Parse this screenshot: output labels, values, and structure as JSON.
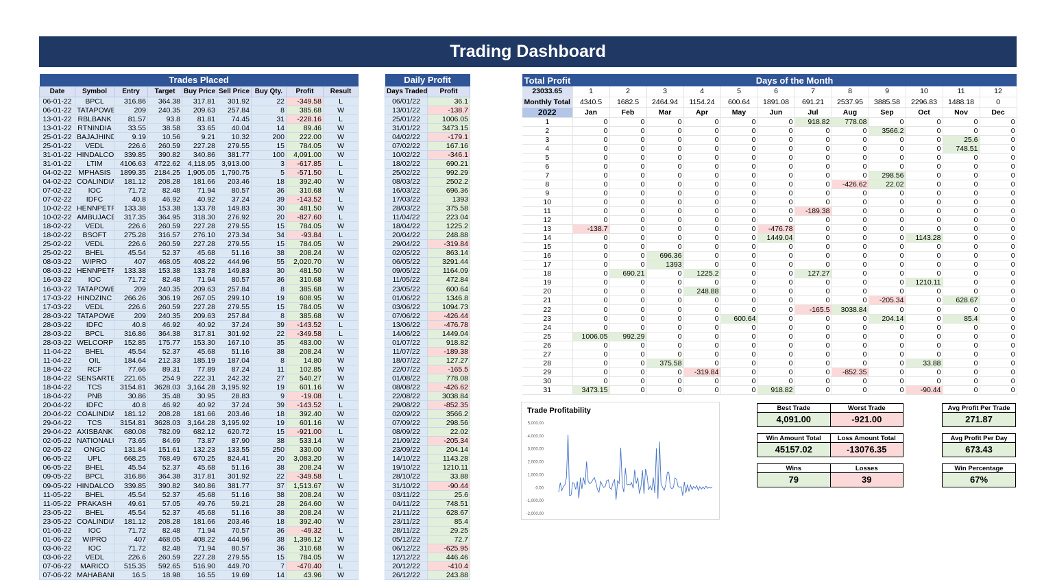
{
  "title": "Trading Dashboard",
  "trades": {
    "header": "Trades Placed",
    "columns": [
      "Date",
      "Symbol",
      "Entry",
      "Target",
      "Buy Price",
      "Sell Price",
      "Buy Qty.",
      "Profit",
      "Result"
    ],
    "rows": [
      [
        "06-01-22",
        "BPCL",
        "316.86",
        "364.38",
        "317.81",
        "301.92",
        "22",
        "-349.58",
        "L"
      ],
      [
        "06-01-22",
        "TATAPOWER",
        "209",
        "240.35",
        "209.63",
        "257.84",
        "8",
        "385.68",
        "W"
      ],
      [
        "13-01-22",
        "RBLBANK",
        "81.57",
        "93.8",
        "81.81",
        "74.45",
        "31",
        "-228.16",
        "L"
      ],
      [
        "13-01-22",
        "RTNINDIA",
        "33.55",
        "38.58",
        "33.65",
        "40.04",
        "14",
        "89.46",
        "W"
      ],
      [
        "25-01-22",
        "BAJAJHIND",
        "9.19",
        "10.56",
        "9.21",
        "10.32",
        "200",
        "222.00",
        "W"
      ],
      [
        "25-01-22",
        "VEDL",
        "226.6",
        "260.59",
        "227.28",
        "279.55",
        "15",
        "784.05",
        "W"
      ],
      [
        "31-01-22",
        "HINDALCO",
        "339.85",
        "390.82",
        "340.86",
        "381.77",
        "100",
        "4,091.00",
        "W"
      ],
      [
        "31-01-22",
        "LTIM",
        "4106.63",
        "4722.62",
        "4,118.95",
        "3,913.00",
        "3",
        "-617.85",
        "L"
      ],
      [
        "04-02-22",
        "MPHASIS",
        "1899.35",
        "2184.25",
        "1,905.05",
        "1,790.75",
        "5",
        "-571.50",
        "L"
      ],
      [
        "04-02-22",
        "COALINDIA",
        "181.12",
        "208.28",
        "181.66",
        "203.46",
        "18",
        "392.40",
        "W"
      ],
      [
        "07-02-22",
        "IOC",
        "71.72",
        "82.48",
        "71.94",
        "80.57",
        "36",
        "310.68",
        "W"
      ],
      [
        "07-02-22",
        "IDFC",
        "40.8",
        "46.92",
        "40.92",
        "37.24",
        "39",
        "-143.52",
        "L"
      ],
      [
        "10-02-22",
        "HENNPETRO",
        "133.38",
        "153.38",
        "133.78",
        "149.83",
        "30",
        "481.50",
        "W"
      ],
      [
        "10-02-22",
        "AMBUJACEM",
        "317.35",
        "364.95",
        "318.30",
        "276.92",
        "20",
        "-827.60",
        "L"
      ],
      [
        "18-02-22",
        "VEDL",
        "226.6",
        "260.59",
        "227.28",
        "279.55",
        "15",
        "784.05",
        "W"
      ],
      [
        "18-02-22",
        "BSOFT",
        "275.28",
        "316.57",
        "276.10",
        "273.34",
        "34",
        "-93.84",
        "L"
      ],
      [
        "25-02-22",
        "VEDL",
        "226.6",
        "260.59",
        "227.28",
        "279.55",
        "15",
        "784.05",
        "W"
      ],
      [
        "25-02-22",
        "BHEL",
        "45.54",
        "52.37",
        "45.68",
        "51.16",
        "38",
        "208.24",
        "W"
      ],
      [
        "08-03-22",
        "WIPRO",
        "407",
        "468.05",
        "408.22",
        "444.96",
        "55",
        "2,020.70",
        "W"
      ],
      [
        "08-03-22",
        "HENNPETRO",
        "133.38",
        "153.38",
        "133.78",
        "149.83",
        "30",
        "481.50",
        "W"
      ],
      [
        "16-03-22",
        "IOC",
        "71.72",
        "82.48",
        "71.94",
        "80.57",
        "36",
        "310.68",
        "W"
      ],
      [
        "16-03-22",
        "TATAPOWER",
        "209",
        "240.35",
        "209.63",
        "257.84",
        "8",
        "385.68",
        "W"
      ],
      [
        "17-03-22",
        "HINDZINC",
        "266.26",
        "306.19",
        "267.05",
        "299.10",
        "19",
        "608.95",
        "W"
      ],
      [
        "17-03-22",
        "VEDL",
        "226.6",
        "260.59",
        "227.28",
        "279.55",
        "15",
        "784.05",
        "W"
      ],
      [
        "28-03-22",
        "TATAPOWER",
        "209",
        "240.35",
        "209.63",
        "257.84",
        "8",
        "385.68",
        "W"
      ],
      [
        "28-03-22",
        "IDFC",
        "40.8",
        "46.92",
        "40.92",
        "37.24",
        "39",
        "-143.52",
        "L"
      ],
      [
        "28-03-22",
        "BPCL",
        "316.86",
        "364.38",
        "317.81",
        "301.92",
        "22",
        "-349.58",
        "L"
      ],
      [
        "28-03-22",
        "WELCORP",
        "152.85",
        "175.77",
        "153.30",
        "167.10",
        "35",
        "483.00",
        "W"
      ],
      [
        "11-04-22",
        "BHEL",
        "45.54",
        "52.37",
        "45.68",
        "51.16",
        "38",
        "208.24",
        "W"
      ],
      [
        "11-04-22",
        "OIL",
        "184.64",
        "212.33",
        "185.19",
        "187.04",
        "8",
        "14.80",
        "W"
      ],
      [
        "18-04-22",
        "RCF",
        "77.66",
        "89.31",
        "77.89",
        "87.24",
        "11",
        "102.85",
        "W"
      ],
      [
        "18-04-22",
        "SENSARTECH",
        "221.65",
        "254.9",
        "222.31",
        "242.32",
        "27",
        "540.27",
        "W"
      ],
      [
        "18-04-22",
        "TCS",
        "3154.81",
        "3628.03",
        "3,164.28",
        "3,195.92",
        "19",
        "601.16",
        "W"
      ],
      [
        "18-04-22",
        "PNB",
        "30.86",
        "35.48",
        "30.95",
        "28.83",
        "9",
        "-19.08",
        "L"
      ],
      [
        "20-04-22",
        "IDFC",
        "40.8",
        "46.92",
        "40.92",
        "37.24",
        "39",
        "-143.52",
        "L"
      ],
      [
        "20-04-22",
        "COALINDIA",
        "181.12",
        "208.28",
        "181.66",
        "203.46",
        "18",
        "392.40",
        "W"
      ],
      [
        "29-04-22",
        "TCS",
        "3154.81",
        "3628.03",
        "3,164.28",
        "3,195.92",
        "19",
        "601.16",
        "W"
      ],
      [
        "29-04-22",
        "AXISBANK",
        "680.08",
        "782.09",
        "682.12",
        "620.72",
        "15",
        "-921.00",
        "L"
      ],
      [
        "02-05-22",
        "NATIONALUM",
        "73.65",
        "84.69",
        "73.87",
        "87.90",
        "38",
        "533.14",
        "W"
      ],
      [
        "02-05-22",
        "ONGC",
        "131.84",
        "151.61",
        "132.23",
        "133.55",
        "250",
        "330.00",
        "W"
      ],
      [
        "06-05-22",
        "UPL",
        "668.25",
        "768.49",
        "670.25",
        "824.41",
        "20",
        "3,083.20",
        "W"
      ],
      [
        "06-05-22",
        "BHEL",
        "45.54",
        "52.37",
        "45.68",
        "51.16",
        "38",
        "208.24",
        "W"
      ],
      [
        "09-05-22",
        "BPCL",
        "316.86",
        "364.38",
        "317.81",
        "301.92",
        "22",
        "-349.58",
        "L"
      ],
      [
        "09-05-22",
        "HINDALCO",
        "339.85",
        "390.82",
        "340.86",
        "381.77",
        "37",
        "1,513.67",
        "W"
      ],
      [
        "11-05-22",
        "BHEL",
        "45.54",
        "52.37",
        "45.68",
        "51.16",
        "38",
        "208.24",
        "W"
      ],
      [
        "11-05-22",
        "PRAKASH",
        "49.61",
        "57.05",
        "49.76",
        "59.21",
        "28",
        "264.60",
        "W"
      ],
      [
        "23-05-22",
        "BHEL",
        "45.54",
        "52.37",
        "45.68",
        "51.16",
        "38",
        "208.24",
        "W"
      ],
      [
        "23-05-22",
        "COALINDIA",
        "181.12",
        "208.28",
        "181.66",
        "203.46",
        "18",
        "392.40",
        "W"
      ],
      [
        "01-06-22",
        "IOC",
        "71.72",
        "82.48",
        "71.94",
        "70.57",
        "36",
        "-49.32",
        "L"
      ],
      [
        "01-06-22",
        "WIPRO",
        "407",
        "468.05",
        "408.22",
        "444.96",
        "38",
        "1,396.12",
        "W"
      ],
      [
        "03-06-22",
        "IOC",
        "71.72",
        "82.48",
        "71.94",
        "80.57",
        "36",
        "310.68",
        "W"
      ],
      [
        "03-06-22",
        "VEDL",
        "226.6",
        "260.59",
        "227.28",
        "279.55",
        "15",
        "784.05",
        "W"
      ],
      [
        "07-06-22",
        "MARICO",
        "515.35",
        "592.65",
        "516.90",
        "449.70",
        "7",
        "-470.40",
        "L"
      ],
      [
        "07-06-22",
        "MAHABANK",
        "16.5",
        "18.98",
        "16.55",
        "19.69",
        "14",
        "43.96",
        "W"
      ]
    ]
  },
  "daily": {
    "header": "Daily Profit",
    "columns": [
      "Days Traded",
      "Profit"
    ],
    "rows": [
      [
        "06/01/22",
        "36.1"
      ],
      [
        "13/01/22",
        "-138.7"
      ],
      [
        "25/01/22",
        "1006.05"
      ],
      [
        "31/01/22",
        "3473.15"
      ],
      [
        "04/02/22",
        "-179.1"
      ],
      [
        "07/02/22",
        "167.16"
      ],
      [
        "10/02/22",
        "-346.1"
      ],
      [
        "18/02/22",
        "690.21"
      ],
      [
        "25/02/22",
        "992.29"
      ],
      [
        "08/03/22",
        "2502.2"
      ],
      [
        "16/03/22",
        "696.36"
      ],
      [
        "17/03/22",
        "1393"
      ],
      [
        "28/03/22",
        "375.58"
      ],
      [
        "11/04/22",
        "223.04"
      ],
      [
        "18/04/22",
        "1225.2"
      ],
      [
        "20/04/22",
        "248.88"
      ],
      [
        "29/04/22",
        "-319.84"
      ],
      [
        "02/05/22",
        "863.14"
      ],
      [
        "06/05/22",
        "3291.44"
      ],
      [
        "09/05/22",
        "1164.09"
      ],
      [
        "11/05/22",
        "472.84"
      ],
      [
        "23/05/22",
        "600.64"
      ],
      [
        "01/06/22",
        "1346.8"
      ],
      [
        "03/06/22",
        "1094.73"
      ],
      [
        "07/06/22",
        "-426.44"
      ],
      [
        "13/06/22",
        "-476.78"
      ],
      [
        "14/06/22",
        "1449.04"
      ],
      [
        "01/07/22",
        "918.82"
      ],
      [
        "11/07/22",
        "-189.38"
      ],
      [
        "18/07/22",
        "127.27"
      ],
      [
        "22/07/22",
        "-165.5"
      ],
      [
        "01/08/22",
        "778.08"
      ],
      [
        "08/08/22",
        "-426.62"
      ],
      [
        "22/08/22",
        "3038.84"
      ],
      [
        "29/08/22",
        "-852.35"
      ],
      [
        "02/09/22",
        "3566.2"
      ],
      [
        "07/09/22",
        "298.56"
      ],
      [
        "08/09/22",
        "22.02"
      ],
      [
        "21/09/22",
        "-205.34"
      ],
      [
        "23/09/22",
        "204.14"
      ],
      [
        "14/10/22",
        "1143.28"
      ],
      [
        "19/10/22",
        "1210.11"
      ],
      [
        "28/10/22",
        "33.88"
      ],
      [
        "31/10/22",
        "-90.44"
      ],
      [
        "03/11/22",
        "25.6"
      ],
      [
        "04/11/22",
        "748.51"
      ],
      [
        "21/11/22",
        "628.67"
      ],
      [
        "23/11/22",
        "85.4"
      ],
      [
        "28/11/22",
        "29.25"
      ],
      [
        "05/12/22",
        "72.7"
      ],
      [
        "06/12/22",
        "-625.95"
      ],
      [
        "12/12/22",
        "446.46"
      ],
      [
        "20/12/22",
        "-410.4"
      ],
      [
        "26/12/22",
        "243.88"
      ]
    ]
  },
  "grid": {
    "total_profit_label": "Total Profit",
    "total_profit": "23033.65",
    "header": "Days of the Month",
    "monthly_total_label": "Monthly Total",
    "year": "2022",
    "month_numbers": [
      "1",
      "2",
      "3",
      "4",
      "5",
      "6",
      "7",
      "8",
      "9",
      "10",
      "11",
      "12"
    ],
    "monthly_totals": [
      "4340.5",
      "1682.5",
      "2464.94",
      "1154.24",
      "600.64",
      "1891.08",
      "691.21",
      "2537.95",
      "3885.58",
      "2296.83",
      "1488.18",
      "0"
    ],
    "months": [
      "Jan",
      "Feb",
      "Mar",
      "Apr",
      "May",
      "Jun",
      "Jul",
      "Aug",
      "Sep",
      "Oct",
      "Nov",
      "Dec"
    ],
    "days": [
      "1",
      "2",
      "3",
      "4",
      "5",
      "6",
      "7",
      "8",
      "9",
      "10",
      "11",
      "12",
      "13",
      "14",
      "15",
      "16",
      "17",
      "18",
      "19",
      "20",
      "21",
      "22",
      "23",
      "24",
      "25",
      "26",
      "27",
      "28",
      "29",
      "30",
      "31"
    ],
    "nonzero": [
      {
        "day": 1,
        "month": 7,
        "v": "918.82"
      },
      {
        "day": 1,
        "month": 8,
        "v": "778.08"
      },
      {
        "day": 2,
        "month": 9,
        "v": "3566.2"
      },
      {
        "day": 3,
        "month": 11,
        "v": "25.6"
      },
      {
        "day": 4,
        "month": 11,
        "v": "748.51"
      },
      {
        "day": 7,
        "month": 9,
        "v": "298.56"
      },
      {
        "day": 8,
        "month": 8,
        "v": "-426.62"
      },
      {
        "day": 8,
        "month": 9,
        "v": "22.02"
      },
      {
        "day": 11,
        "month": 7,
        "v": "-189.38"
      },
      {
        "day": 13,
        "month": 1,
        "v": "-138.7"
      },
      {
        "day": 13,
        "month": 6,
        "v": "-476.78"
      },
      {
        "day": 14,
        "month": 6,
        "v": "1449.04"
      },
      {
        "day": 14,
        "month": 10,
        "v": "1143.28"
      },
      {
        "day": 16,
        "month": 3,
        "v": "696.36"
      },
      {
        "day": 17,
        "month": 3,
        "v": "1393"
      },
      {
        "day": 18,
        "month": 2,
        "v": "690.21"
      },
      {
        "day": 18,
        "month": 4,
        "v": "1225.2"
      },
      {
        "day": 18,
        "month": 7,
        "v": "127.27"
      },
      {
        "day": 19,
        "month": 10,
        "v": "1210.11"
      },
      {
        "day": 20,
        "month": 4,
        "v": "248.88"
      },
      {
        "day": 21,
        "month": 9,
        "v": "-205.34"
      },
      {
        "day": 21,
        "month": 11,
        "v": "628.67"
      },
      {
        "day": 22,
        "month": 7,
        "v": "-165.5"
      },
      {
        "day": 22,
        "month": 8,
        "v": "3038.84"
      },
      {
        "day": 23,
        "month": 5,
        "v": "600.64"
      },
      {
        "day": 23,
        "month": 9,
        "v": "204.14"
      },
      {
        "day": 23,
        "month": 11,
        "v": "85.4"
      },
      {
        "day": 25,
        "month": 1,
        "v": "1006.05"
      },
      {
        "day": 25,
        "month": 2,
        "v": "992.29"
      },
      {
        "day": 28,
        "month": 3,
        "v": "375.58"
      },
      {
        "day": 28,
        "month": 10,
        "v": "33.88"
      },
      {
        "day": 29,
        "month": 4,
        "v": "-319.84"
      },
      {
        "day": 29,
        "month": 8,
        "v": "-852.35"
      },
      {
        "day": 31,
        "month": 1,
        "v": "3473.15"
      },
      {
        "day": 31,
        "month": 6,
        "v": "918.82"
      },
      {
        "day": 31,
        "month": 10,
        "v": "-90.44"
      }
    ]
  },
  "chart_data": {
    "type": "line",
    "title": "Trade Profitability",
    "ylim": [
      -2000,
      5000
    ],
    "yticks": [
      "5,000.00",
      "4,000.00",
      "3,000.00",
      "2,000.00",
      "1,000.00",
      "0.00",
      "-1,000.00",
      "-2,000.00"
    ],
    "series": [
      {
        "values": [
          -349.58,
          385.68,
          -228.16,
          89.46,
          222,
          784.05,
          4091,
          -617.85,
          -571.5,
          392.4,
          310.68,
          -143.52,
          481.5,
          -827.6,
          784.05,
          -93.84,
          784.05,
          208.24,
          2020.7,
          481.5,
          310.68,
          385.68,
          608.95,
          784.05,
          385.68,
          -143.52,
          -349.58,
          483,
          208.24,
          14.8,
          102.85,
          540.27,
          601.16,
          -19.08,
          -143.52,
          392.4,
          601.16,
          -921,
          533.14,
          330,
          3083.2,
          208.24,
          -349.58,
          1513.67,
          208.24,
          264.6,
          208.24,
          392.4,
          -49.32,
          1396.12,
          310.68,
          784.05,
          -470.4,
          43.96,
          1346.8,
          -476.78,
          1449.04,
          918.82,
          -189.38,
          127.27,
          -165.5,
          778.08,
          -426.62,
          3038.84,
          -852.35,
          3566.2,
          298.56,
          22.02,
          -205.34,
          204.14,
          1143.28,
          1210.11,
          33.88,
          -90.44,
          25.6,
          748.51,
          628.67,
          85.4,
          29.25,
          72.7,
          -625.95,
          446.46,
          -410.4,
          243.88,
          -300,
          200,
          -150,
          100,
          -50,
          150,
          -200,
          80,
          -120,
          60,
          -90,
          120,
          -60,
          40,
          -30,
          20
        ]
      }
    ]
  },
  "kpis": {
    "best_trade_label": "Best Trade",
    "best_trade": "4,091.00",
    "worst_trade_label": "Worst Trade",
    "worst_trade": "-921.00",
    "win_amount_label": "Win Amount Total",
    "win_amount": "45157.02",
    "loss_amount_label": "Loss Amount Total",
    "loss_amount": "-13076.35",
    "wins_label": "Wins",
    "wins": "79",
    "losses_label": "Losses",
    "losses": "39",
    "avg_trade_label": "Avg Profit Per Trade",
    "avg_trade": "271.87",
    "avg_day_label": "Avg Profit Per Day",
    "avg_day": "673.43",
    "win_pct_label": "Win Percentage",
    "win_pct": "67%"
  }
}
